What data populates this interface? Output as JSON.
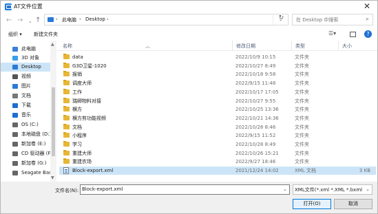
{
  "window": {
    "title": "AT文件位置"
  },
  "address": {
    "crumbs": [
      "此电脑",
      "Desktop"
    ]
  },
  "search": {
    "placeholder": "在 Desktop 中搜索"
  },
  "toolbar": {
    "organize": "组织 ▾",
    "new_folder": "新建文件夹"
  },
  "sidebar": {
    "items": [
      {
        "label": "此电脑",
        "icon": "computer-icon",
        "color": "#3a7fd8"
      },
      {
        "label": "3D 对象",
        "icon": "cube-icon",
        "color": "#3aa0e8"
      },
      {
        "label": "Desktop",
        "icon": "desktop-icon",
        "color": "#2a7ad8"
      },
      {
        "label": "视频",
        "icon": "video-icon",
        "color": "#555555"
      },
      {
        "label": "图片",
        "icon": "picture-icon",
        "color": "#2a7ad8"
      },
      {
        "label": "文档",
        "icon": "document-icon",
        "color": "#777777"
      },
      {
        "label": "下载",
        "icon": "download-icon",
        "color": "#1e6fd0"
      },
      {
        "label": "音乐",
        "icon": "music-icon",
        "color": "#1e6fd0"
      },
      {
        "label": "OS (C:)",
        "icon": "drive-icon",
        "color": "#666666"
      },
      {
        "label": "本地磁盘 (D:)",
        "icon": "drive-icon",
        "color": "#666666"
      },
      {
        "label": "新加卷 (E:)",
        "icon": "drive-icon",
        "color": "#666666"
      },
      {
        "label": "CD 驱动器 (F",
        "icon": "cd-drive-icon",
        "color": "#666666"
      },
      {
        "label": "新加卷 (G:)",
        "icon": "drive-icon",
        "color": "#666666"
      },
      {
        "label": "Seagate Bas",
        "icon": "drive-icon",
        "color": "#666666"
      }
    ]
  },
  "columns": {
    "name": "名称",
    "date": "修改日期",
    "type": "类型",
    "size": "大小"
  },
  "files": [
    {
      "name": "data",
      "date": "2022/10/9 10:15",
      "type": "文件夹",
      "size": ""
    },
    {
      "name": "G3D卫星-1020",
      "date": "2022/10/27 8:49",
      "type": "文件夹",
      "size": ""
    },
    {
      "name": "报销",
      "date": "2022/10/18 9:58",
      "type": "文件夹",
      "size": ""
    },
    {
      "name": "调度大师",
      "date": "2022/9/15 11:48",
      "type": "文件夹",
      "size": ""
    },
    {
      "name": "工作",
      "date": "2022/10/17 17:05",
      "type": "文件夹",
      "size": ""
    },
    {
      "name": "瑞卿物料对接",
      "date": "2022/10/27 9:55",
      "type": "文件夹",
      "size": ""
    },
    {
      "name": "横方",
      "date": "2022/10/25 13:36",
      "type": "文件夹",
      "size": ""
    },
    {
      "name": "横方剪功能视频",
      "date": "2022/10/21 14:36",
      "type": "文件夹",
      "size": ""
    },
    {
      "name": "文档",
      "date": "2022/10/28 8:46",
      "type": "文件夹",
      "size": ""
    },
    {
      "name": "小程序",
      "date": "2022/9/15 11:52",
      "type": "文件夹",
      "size": ""
    },
    {
      "name": "学习",
      "date": "2022/10/28 8:49",
      "type": "文件夹",
      "size": ""
    },
    {
      "name": "重建大师",
      "date": "2022/10/26 15:21",
      "type": "文件夹",
      "size": ""
    },
    {
      "name": "重建农场",
      "date": "2022/9/27 18:46",
      "type": "文件夹",
      "size": ""
    },
    {
      "name": "Block-export.xml",
      "date": "2021/12/24 14:02",
      "type": "XML 文档",
      "size": "3 KB"
    }
  ],
  "footer": {
    "filename_label": "文件名(N):",
    "filename_value": "Block-export.xml",
    "filetype_value": "XML文件(*.xml *.XML *.bxml",
    "open_label": "打开(O)",
    "cancel_label": "取消"
  }
}
